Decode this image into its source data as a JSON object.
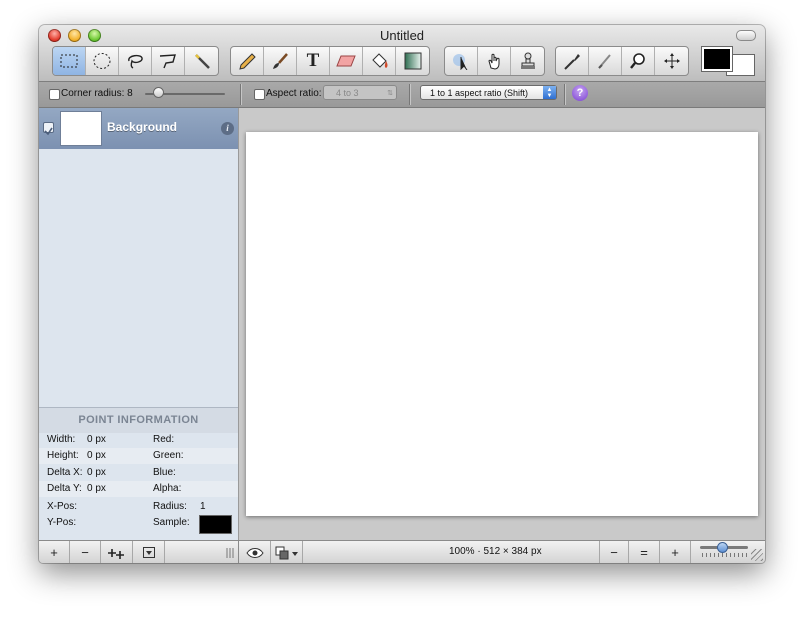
{
  "window": {
    "title": "Untitled"
  },
  "toolbar": {
    "tools": [
      {
        "icon": "rectangle-select-icon"
      },
      {
        "icon": "ellipse-select-icon"
      },
      {
        "icon": "lasso-icon"
      },
      {
        "icon": "polygon-lasso-icon"
      },
      {
        "icon": "magic-wand-icon"
      },
      {
        "icon": "pencil-icon"
      },
      {
        "icon": "brush-icon"
      },
      {
        "icon": "text-icon",
        "glyph": "T"
      },
      {
        "icon": "eraser-icon"
      },
      {
        "icon": "paint-bucket-icon"
      },
      {
        "icon": "gradient-icon"
      },
      {
        "icon": "pointer-icon"
      },
      {
        "icon": "hand-icon"
      },
      {
        "icon": "clone-stamp-icon"
      },
      {
        "icon": "eyedropper-icon"
      },
      {
        "icon": "smudge-icon"
      },
      {
        "icon": "zoom-icon"
      },
      {
        "icon": "move-icon"
      }
    ],
    "colors": {
      "foreground": "#000000",
      "background": "#ffffff"
    }
  },
  "options": {
    "corner_radius_label": "Corner radius: 8",
    "aspect_ratio_label": "Aspect ratio:",
    "aspect_ratio_value": "4 to 3",
    "aspect_mode_value": "1 to 1 aspect ratio (Shift)",
    "help_label": "?"
  },
  "layers": [
    {
      "name": "Background",
      "checked": true
    }
  ],
  "point_info": {
    "title": "POINT INFORMATION",
    "width_label": "Width:",
    "width_value": "0 px",
    "height_label": "Height:",
    "height_value": "0 px",
    "deltax_label": "Delta X:",
    "deltax_value": "0 px",
    "deltay_label": "Delta Y:",
    "deltay_value": "0 px",
    "xpos_label": "X-Pos:",
    "ypos_label": "Y-Pos:",
    "red_label": "Red:",
    "green_label": "Green:",
    "blue_label": "Blue:",
    "alpha_label": "Alpha:",
    "radius_label": "Radius:",
    "radius_value": "1",
    "sample_label": "Sample:",
    "sample_color": "#000000"
  },
  "bottom": {
    "add_label": "+",
    "remove_label": "−",
    "zoom_text": "100% · 512 × 384 px",
    "zoom_out_label": "−",
    "zoom_actual_label": "=",
    "zoom_in_label": "+"
  }
}
